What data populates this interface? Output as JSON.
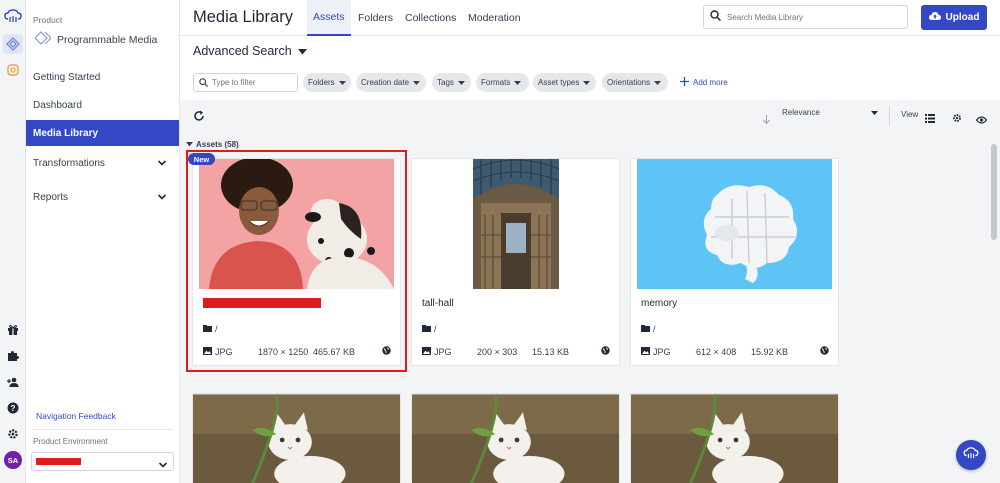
{
  "sidebar": {
    "product_label": "Product",
    "product_name": "Programmable Media",
    "items": [
      {
        "label": "Getting Started"
      },
      {
        "label": "Dashboard"
      },
      {
        "label": "Media Library"
      },
      {
        "label": "Transformations"
      },
      {
        "label": "Reports"
      }
    ],
    "feedback": "Navigation Feedback",
    "env_label": "Product Environment",
    "avatar_initials": "SA"
  },
  "header": {
    "title": "Media Library",
    "tabs": [
      {
        "label": "Assets",
        "active": true
      },
      {
        "label": "Folders"
      },
      {
        "label": "Collections"
      },
      {
        "label": "Moderation"
      }
    ],
    "search_placeholder": "Search Media Library",
    "upload_label": "Upload"
  },
  "advanced": {
    "title": "Advanced Search",
    "filter_placeholder": "Type to filter",
    "chips": [
      "Folders",
      "Creation date",
      "Tags",
      "Formats",
      "Asset types",
      "Orientations"
    ],
    "add_more": "Add more"
  },
  "toolbar": {
    "sort": "Relevance",
    "view_label": "View"
  },
  "assets": {
    "header": "Assets (58)",
    "new_badge": "New",
    "cards": [
      {
        "name": "",
        "folder": "/",
        "format": "JPG",
        "dims": "1870 × 1250",
        "size": "465.67 KB"
      },
      {
        "name": "tall-hall",
        "folder": "/",
        "format": "JPG",
        "dims": "200 × 303",
        "size": "15.13 KB"
      },
      {
        "name": "memory",
        "folder": "/",
        "format": "JPG",
        "dims": "612 × 408",
        "size": "15.92 KB"
      }
    ]
  },
  "colors": {
    "accent": "#3448c5",
    "redaction": "#e01b1b"
  }
}
